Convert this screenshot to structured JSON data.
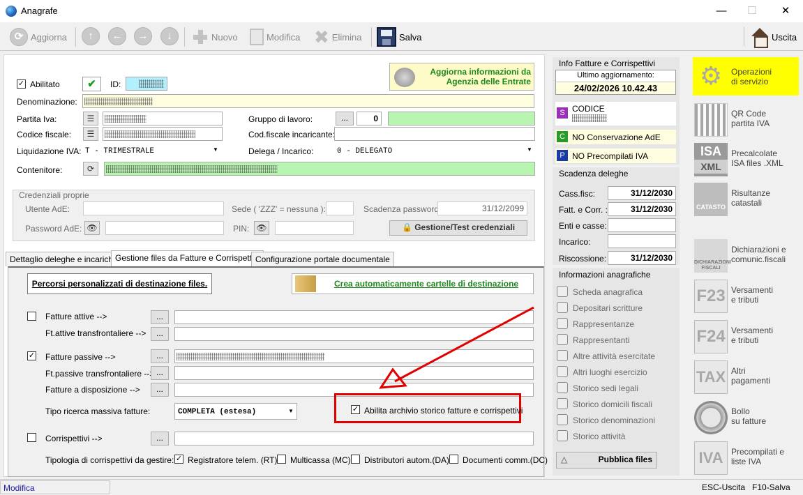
{
  "window": {
    "title": "Anagrafe",
    "min": "—",
    "max": "☐",
    "close": "✕"
  },
  "toolbar": {
    "refresh": "Aggiorna",
    "new": "Nuovo",
    "edit": "Modifica",
    "delete": "Elimina",
    "save": "Salva",
    "exit": "Uscita"
  },
  "header": {
    "enabled_label": "Abilitato",
    "id_label": "ID:",
    "ade_button": "Aggiorna informazioni da\nAgenzia delle Entrate"
  },
  "form": {
    "denominazione": "Denominazione:",
    "partita_iva": "Partita Iva:",
    "codice_fiscale": "Codice fiscale:",
    "liquidazione": "Liquidazione IVA:",
    "liquidazione_value": "T  -  TRIMESTRALE",
    "contenitore": "Contenitore:",
    "gruppo": "Gruppo di lavoro:",
    "gruppo_btn": "...",
    "gruppo_value": "0",
    "cf_incaricante": "Cod.fiscale incaricante:",
    "delega": "Delega / Incarico:",
    "delega_value": "0  -  DELEGATO"
  },
  "credentials": {
    "title": "Credenziali proprie",
    "utente": "Utente AdE:",
    "sede": "Sede ( 'ZZZ' = nessuna ):",
    "scadenza": "Scadenza password:",
    "scadenza_value": "31/12/2099",
    "password": "Password AdE:",
    "pin": "PIN:",
    "gestione_btn": "Gestione/Test credenziali"
  },
  "tabs": [
    "Dettaglio deleghe e incarichi",
    "Gestione files da Fatture e Corrispettivi",
    "Configurazione portale documentale"
  ],
  "tab_content": {
    "percorsi_btn": "Percorsi personalizzati di destinazione files.",
    "crea_btn": "Crea automaticamente cartelle di destinazione",
    "fatture_attive": "Fatture attive -->",
    "ft_attive_tf": "Ft.attive transfrontaliere -->",
    "fatture_passive": "Fatture passive -->",
    "ft_passive_tf": "Ft.passive transfrontaliere -->",
    "fatture_disp": "Fatture a disposizione -->",
    "tipo_ricerca": "Tipo ricerca massiva fatture:",
    "tipo_ricerca_value": "COMPLETA (estesa)",
    "archivio": "Abilita archivio storico fatture e corrispettivi",
    "corrispettivi": "Corrispettivi -->",
    "tipologia": "Tipologia di corrispettivi da gestire:",
    "rt": "Registratore telem. (RT)",
    "mc": "Multicassa (MC)",
    "da": "Distributori autom.(DA)",
    "dc": "Documenti comm.(DC)",
    "dots": "..."
  },
  "info_fatture": {
    "title": "Info Fatture e Corrispettivi",
    "ultimo": "Ultimo aggiornamento:",
    "ultimo_value": "24/02/2026 10.42.43",
    "codice": "CODICE",
    "conservazione": "NO Conservazione AdE",
    "precompilati": "NO Precompilati IVA",
    "badge_s": "S",
    "badge_c": "C",
    "badge_p": "P"
  },
  "scadenza": {
    "title": "Scadenza deleghe",
    "rows": [
      {
        "label": "Cass.fisc:",
        "value": "31/12/2030"
      },
      {
        "label": "Fatt. e Corr. :",
        "value": "31/12/2030"
      },
      {
        "label": "Enti e casse:",
        "value": ""
      },
      {
        "label": "Incarico:",
        "value": ""
      },
      {
        "label": "Riscossione:",
        "value": "31/12/2030"
      }
    ]
  },
  "info_anag": {
    "title": "Informazioni anagrafiche",
    "items": [
      "Scheda anagrafica",
      "Depositari scritture",
      "Rappresentanze",
      "Rappresentanti",
      "Altre attività esercitate",
      "Altri luoghi esercizio",
      "Storico sedi legali",
      "Storico domicili fiscali",
      "Storico denominazioni",
      "Storico attività"
    ],
    "publish": "Pubblica files"
  },
  "tools": [
    {
      "label": "Operazioni\ndi servizio",
      "icon": "gear-icon"
    },
    {
      "label": "QR Code\npartita IVA",
      "icon": "qrcode-icon"
    },
    {
      "label": "Precalcolate\nISA files .XML",
      "icon": "isa-xml-icon"
    },
    {
      "label": "Risultanze\ncatastali",
      "icon": "catasto-icon"
    },
    {
      "label": "Dichiarazioni e\ncomunic.fiscali",
      "icon": "dichiarazioni-icon"
    },
    {
      "label": "Versamenti\ne tributi",
      "icon": "f23-icon"
    },
    {
      "label": "Versamenti\ne tributi",
      "icon": "f24-icon"
    },
    {
      "label": "Altri\npagamenti",
      "icon": "tax-icon"
    },
    {
      "label": "Bollo\nsu fatture",
      "icon": "seal-icon"
    },
    {
      "label": "Precompilati e\nliste IVA",
      "icon": "iva-icon"
    }
  ],
  "tool_texts": {
    "isa": "ISA",
    "xml": "XML",
    "catasto": "CATASTO",
    "dichiarazioni": "DICHIARAZIONI\nFISCALI",
    "f23": "F23",
    "f24": "F24",
    "tax": "TAX",
    "iva": "IVA"
  },
  "status": {
    "left": "Modifica",
    "esc": "ESC-Uscita",
    "f10": "F10-Salva"
  },
  "colors": {
    "highlight": "#ffff00",
    "green_field": "#b8f5b0",
    "yellow_field": "#fffde0",
    "arrow": "#e00000"
  }
}
